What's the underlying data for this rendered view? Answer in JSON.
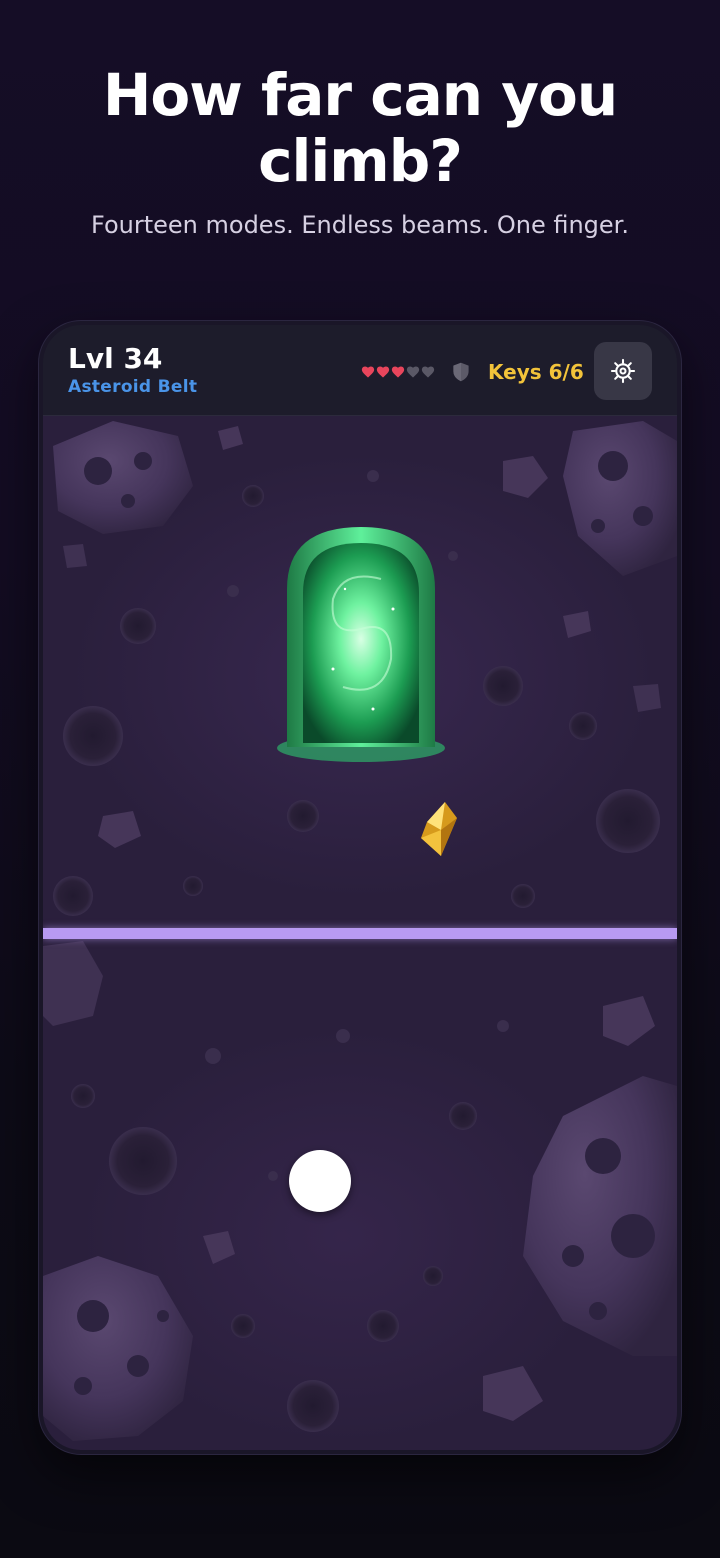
{
  "header": {
    "title": "How far can you climb?",
    "subtitle": "Fourteen modes. Endless beams. One finger."
  },
  "hud": {
    "level": "Lvl 34",
    "zone": "Asteroid Belt",
    "hearts": {
      "filled": 3,
      "total": 5
    },
    "keys": "Keys 6/6",
    "settings_icon": "gear-icon",
    "shield_icon": "shield-icon"
  },
  "game": {
    "portal_icon": "green-portal-icon",
    "crystal_icon": "gold-crystal-icon",
    "player_icon": "white-ball",
    "beam_color": "#b89af2"
  },
  "colors": {
    "zone": "#4a94e8",
    "keys": "#f2c33a",
    "heart_filled": "#e8455c",
    "heart_empty": "#5a5866"
  }
}
